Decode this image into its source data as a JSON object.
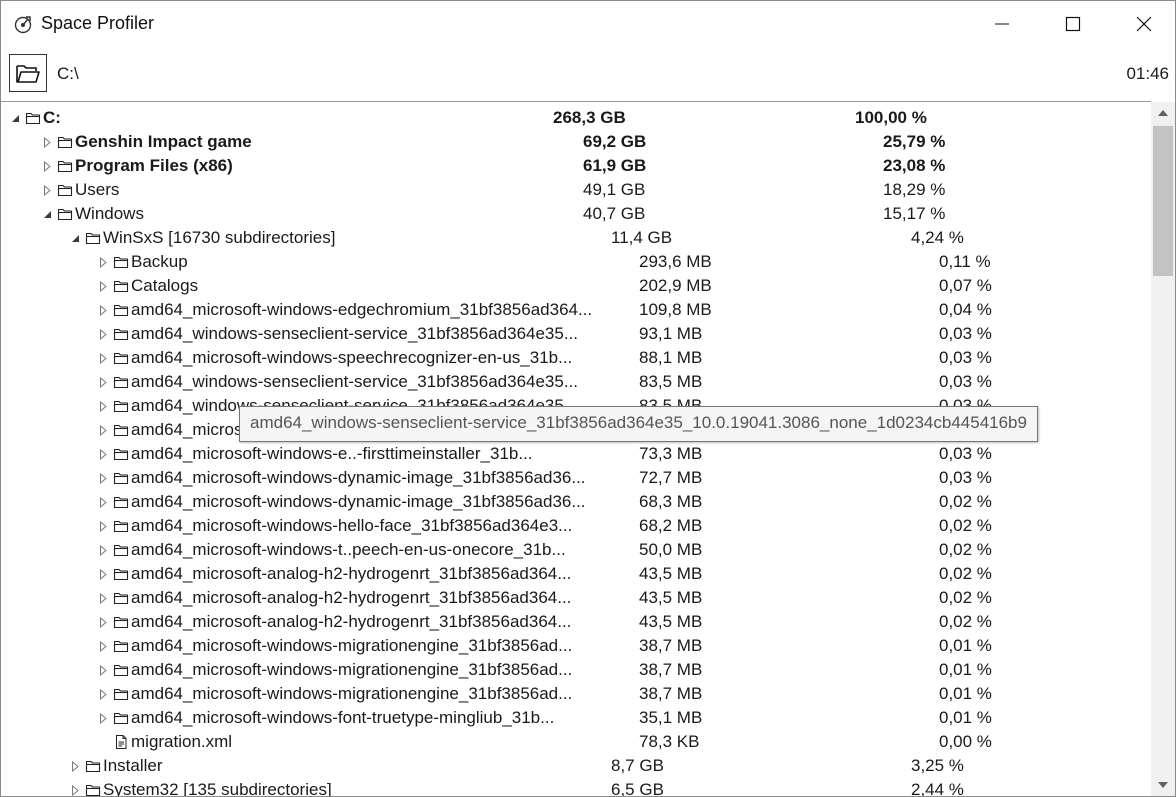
{
  "window": {
    "title": "Space Profiler"
  },
  "toolbar": {
    "path": "C:\\",
    "time": "01:46"
  },
  "tree": {
    "rows": [
      {
        "name": "C:",
        "size": "268,3 GB",
        "percent": "100,00 %",
        "depth": 0,
        "toggle": "expanded",
        "icon": "folder",
        "bold": true
      },
      {
        "name": "Genshin Impact game",
        "size": "69,2 GB",
        "percent": "25,79 %",
        "depth": 1,
        "toggle": "collapsed",
        "icon": "folder",
        "bold": true
      },
      {
        "name": "Program Files (x86)",
        "size": "61,9 GB",
        "percent": "23,08 %",
        "depth": 1,
        "toggle": "collapsed",
        "icon": "folder",
        "bold": true
      },
      {
        "name": "Users",
        "size": "49,1 GB",
        "percent": "18,29 %",
        "depth": 1,
        "toggle": "collapsed",
        "icon": "folder",
        "bold": false
      },
      {
        "name": "Windows",
        "size": "40,7 GB",
        "percent": "15,17 %",
        "depth": 1,
        "toggle": "expanded",
        "icon": "folder",
        "bold": false
      },
      {
        "name": "WinSxS [16730 subdirectories]",
        "size": "11,4 GB",
        "percent": "4,24 %",
        "depth": 2,
        "toggle": "expanded",
        "icon": "folder",
        "bold": false
      },
      {
        "name": "Backup",
        "size": "293,6 MB",
        "percent": "0,11 %",
        "depth": 3,
        "toggle": "collapsed",
        "icon": "folder",
        "bold": false
      },
      {
        "name": "Catalogs",
        "size": "202,9 MB",
        "percent": "0,07 %",
        "depth": 3,
        "toggle": "collapsed",
        "icon": "folder",
        "bold": false
      },
      {
        "name": "amd64_microsoft-windows-edgechromium_31bf3856ad364...",
        "size": "109,8 MB",
        "percent": "0,04 %",
        "depth": 3,
        "toggle": "collapsed",
        "icon": "folder",
        "bold": false
      },
      {
        "name": "amd64_windows-senseclient-service_31bf3856ad364e35...",
        "size": "93,1 MB",
        "percent": "0,03 %",
        "depth": 3,
        "toggle": "collapsed",
        "icon": "folder",
        "bold": false
      },
      {
        "name": "amd64_microsoft-windows-speechrecognizer-en-us_31b...",
        "size": "88,1 MB",
        "percent": "0,03 %",
        "depth": 3,
        "toggle": "collapsed",
        "icon": "folder",
        "bold": false
      },
      {
        "name": "amd64_windows-senseclient-service_31bf3856ad364e35...",
        "size": "83,5 MB",
        "percent": "0,03 %",
        "depth": 3,
        "toggle": "collapsed",
        "icon": "folder",
        "bold": false
      },
      {
        "name": "amd64_windows-senseclient-service_31bf3856ad364e35...",
        "size": "83,5 MB",
        "percent": "0,03 %",
        "depth": 3,
        "toggle": "collapsed",
        "icon": "folder",
        "bold": false
      },
      {
        "name": "amd64_microsoft-windows-...",
        "size": "",
        "percent": "",
        "depth": 3,
        "toggle": "collapsed",
        "icon": "folder",
        "bold": false
      },
      {
        "name": "amd64_microsoft-windows-e..-firsttimeinstaller_31b...",
        "size": "73,3 MB",
        "percent": "0,03 %",
        "depth": 3,
        "toggle": "collapsed",
        "icon": "folder",
        "bold": false
      },
      {
        "name": "amd64_microsoft-windows-dynamic-image_31bf3856ad36...",
        "size": "72,7 MB",
        "percent": "0,03 %",
        "depth": 3,
        "toggle": "collapsed",
        "icon": "folder",
        "bold": false
      },
      {
        "name": "amd64_microsoft-windows-dynamic-image_31bf3856ad36...",
        "size": "68,3 MB",
        "percent": "0,02 %",
        "depth": 3,
        "toggle": "collapsed",
        "icon": "folder",
        "bold": false
      },
      {
        "name": "amd64_microsoft-windows-hello-face_31bf3856ad364e3...",
        "size": "68,2 MB",
        "percent": "0,02 %",
        "depth": 3,
        "toggle": "collapsed",
        "icon": "folder",
        "bold": false
      },
      {
        "name": "amd64_microsoft-windows-t..peech-en-us-onecore_31b...",
        "size": "50,0 MB",
        "percent": "0,02 %",
        "depth": 3,
        "toggle": "collapsed",
        "icon": "folder",
        "bold": false
      },
      {
        "name": "amd64_microsoft-analog-h2-hydrogenrt_31bf3856ad364...",
        "size": "43,5 MB",
        "percent": "0,02 %",
        "depth": 3,
        "toggle": "collapsed",
        "icon": "folder",
        "bold": false
      },
      {
        "name": "amd64_microsoft-analog-h2-hydrogenrt_31bf3856ad364...",
        "size": "43,5 MB",
        "percent": "0,02 %",
        "depth": 3,
        "toggle": "collapsed",
        "icon": "folder",
        "bold": false
      },
      {
        "name": "amd64_microsoft-analog-h2-hydrogenrt_31bf3856ad364...",
        "size": "43,5 MB",
        "percent": "0,02 %",
        "depth": 3,
        "toggle": "collapsed",
        "icon": "folder",
        "bold": false
      },
      {
        "name": "amd64_microsoft-windows-migrationengine_31bf3856ad...",
        "size": "38,7 MB",
        "percent": "0,01 %",
        "depth": 3,
        "toggle": "collapsed",
        "icon": "folder",
        "bold": false
      },
      {
        "name": "amd64_microsoft-windows-migrationengine_31bf3856ad...",
        "size": "38,7 MB",
        "percent": "0,01 %",
        "depth": 3,
        "toggle": "collapsed",
        "icon": "folder",
        "bold": false
      },
      {
        "name": "amd64_microsoft-windows-migrationengine_31bf3856ad...",
        "size": "38,7 MB",
        "percent": "0,01 %",
        "depth": 3,
        "toggle": "collapsed",
        "icon": "folder",
        "bold": false
      },
      {
        "name": "amd64_microsoft-windows-font-truetype-mingliub_31b...",
        "size": "35,1 MB",
        "percent": "0,01 %",
        "depth": 3,
        "toggle": "collapsed",
        "icon": "folder",
        "bold": false
      },
      {
        "name": "migration.xml",
        "size": "78,3 KB",
        "percent": "0,00 %",
        "depth": 3,
        "toggle": "none",
        "icon": "file",
        "bold": false
      },
      {
        "name": "Installer",
        "size": "8,7 GB",
        "percent": "3,25 %",
        "depth": 2,
        "toggle": "collapsed",
        "icon": "folder",
        "bold": false
      },
      {
        "name": "System32 [135 subdirectories]",
        "size": "6,5 GB",
        "percent": "2,44 %",
        "depth": 2,
        "toggle": "collapsed",
        "icon": "folder",
        "bold": false
      }
    ]
  },
  "tooltip": {
    "text": "amd64_windows-senseclient-service_31bf3856ad364e35_10.0.19041.3086_none_1d0234cb445416b9"
  }
}
